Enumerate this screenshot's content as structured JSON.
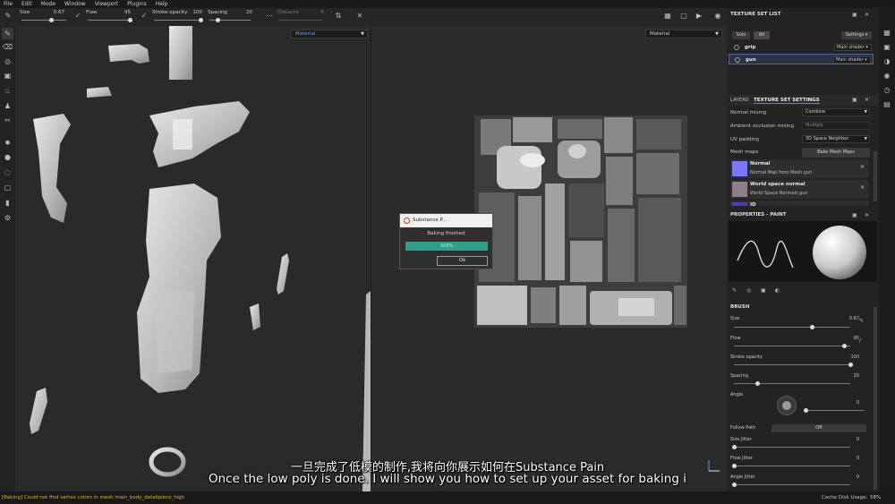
{
  "menu": [
    "File",
    "Edit",
    "Mode",
    "Window",
    "Viewport",
    "Plugins",
    "Help"
  ],
  "toolbar": {
    "size_label": "Size",
    "size_value": "0.67",
    "size_frac": 0.67,
    "flow_label": "Flow",
    "flow_value": "95",
    "flow_frac": 0.95,
    "stroke_label": "Stroke opacity",
    "stroke_value": "100",
    "stroke_frac": 1.0,
    "spacing_label": "Spacing",
    "spacing_value": "20",
    "spacing_frac": 0.2,
    "distance_label": "Distance",
    "distance_value": "6"
  },
  "viewport3d": {
    "mode": "Material"
  },
  "viewport2d": {
    "mode": "Material"
  },
  "dialog": {
    "title": "Substance P...",
    "message": "Baking finished",
    "progress_text": "100%",
    "progress_value": 1.0,
    "ok_label": "Ok"
  },
  "texture_set_list": {
    "title": "TEXTURE SET LIST",
    "solo_label": "Solo",
    "all_label": "All",
    "settings_label": "Settings",
    "items": [
      {
        "name": "grip",
        "shader": "Main shader"
      },
      {
        "name": "gun",
        "shader": "Main shader"
      }
    ]
  },
  "tabs": {
    "layers": "LAYERS",
    "texture_set_settings": "TEXTURE SET SETTINGS"
  },
  "texture_set_settings": {
    "normal_mixing_label": "Normal mixing",
    "normal_mixing_value": "Combine",
    "ao_mixing_label": "Ambient occlusion mixing",
    "ao_mixing_value": "Multiply",
    "uv_padding_label": "UV padding",
    "uv_padding_value": "3D Space Neighbor",
    "mesh_maps_label": "Mesh maps",
    "bake_button": "Bake Mesh Maps",
    "mesh_maps": [
      {
        "title": "Normal",
        "subtitle": "Normal Map from Mesh gun",
        "color": "#7a78ff"
      },
      {
        "title": "World space normal",
        "subtitle": "World Space Normals gun",
        "color": "#8a7f8a"
      },
      {
        "title": "ID",
        "subtitle": "",
        "color": "#4a3fae"
      }
    ]
  },
  "properties": {
    "title": "PROPERTIES - PAINT",
    "brush_section": "BRUSH",
    "size_label": "Size",
    "size_value": "0.67",
    "size_frac": 0.67,
    "flow_label": "Flow",
    "flow_value": "95",
    "flow_frac": 0.95,
    "stroke_label": "Stroke opacity",
    "stroke_value": "100",
    "stroke_frac": 1.0,
    "spacing_label": "Spacing",
    "spacing_value": "20",
    "spacing_frac": 0.2,
    "angle_label": "Angle",
    "angle_value": "0",
    "follow_path_label": "Follow Path",
    "follow_path_value": "Off",
    "size_jitter_label": "Size Jitter",
    "size_jitter_value": "0",
    "flow_jitter_label": "Flow Jitter",
    "flow_jitter_value": "0",
    "angle_jitter_label": "Angle Jitter",
    "angle_jitter_value": "0"
  },
  "statusbar": {
    "message": "[Baking] Could not find vertex colors in mesh main_body_detailpiece_high",
    "cache_label": "Cache Disk Usage:",
    "cache_value": "58%"
  },
  "subtitles": {
    "chinese": "一旦完成了低模的制作,我将向你展示如何在Substance Pain",
    "english": "Once the low poly is done. I will show you how to set up your asset for baking i"
  },
  "colors": {
    "accent": "#2f9e8a",
    "panel_bg": "#232323",
    "viewport_bg": "#2a2a2a",
    "warning_text": "#e0b040"
  }
}
